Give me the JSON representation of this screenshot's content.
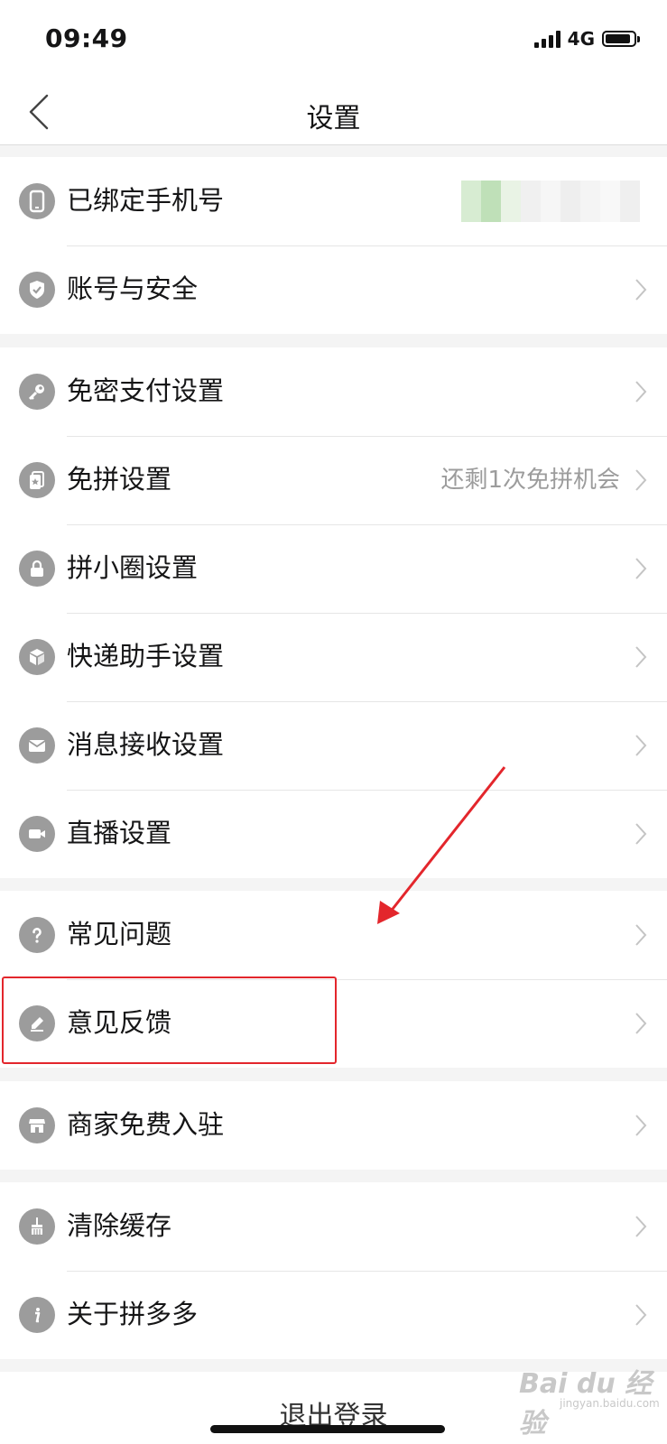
{
  "status_bar": {
    "time": "09:49",
    "network": "4G"
  },
  "nav": {
    "title": "设置"
  },
  "groups": [
    {
      "items": [
        {
          "label": "已绑定手机号",
          "icon": "phone-icon",
          "value_masked": true
        },
        {
          "label": "账号与安全",
          "icon": "shield-check-icon"
        }
      ]
    },
    {
      "items": [
        {
          "label": "免密支付设置",
          "icon": "key-icon"
        },
        {
          "label": "免拼设置",
          "icon": "ticket-star-icon",
          "value": "还剩1次免拼机会"
        },
        {
          "label": "拼小圈设置",
          "icon": "lock-icon"
        },
        {
          "label": "快递助手设置",
          "icon": "package-icon"
        },
        {
          "label": "消息接收设置",
          "icon": "mail-icon"
        },
        {
          "label": "直播设置",
          "icon": "video-camera-icon"
        }
      ]
    },
    {
      "items": [
        {
          "label": "常见问题",
          "icon": "question-icon"
        },
        {
          "label": "意见反馈",
          "icon": "pencil-icon"
        }
      ]
    },
    {
      "items": [
        {
          "label": "商家免费入驻",
          "icon": "storefront-icon"
        }
      ]
    },
    {
      "items": [
        {
          "label": "清除缓存",
          "icon": "broom-icon"
        },
        {
          "label": "关于拼多多",
          "icon": "info-icon"
        }
      ]
    }
  ],
  "logout": {
    "label": "退出登录"
  },
  "annotation": {
    "color": "#e3262c"
  },
  "watermark": {
    "text": "Bai du 经验",
    "sub": "jingyan.baidu.com"
  },
  "colors": {
    "icon_gray": "#9c9c9c",
    "value_gray": "#9c9c9c",
    "background": "#f4f4f4"
  }
}
